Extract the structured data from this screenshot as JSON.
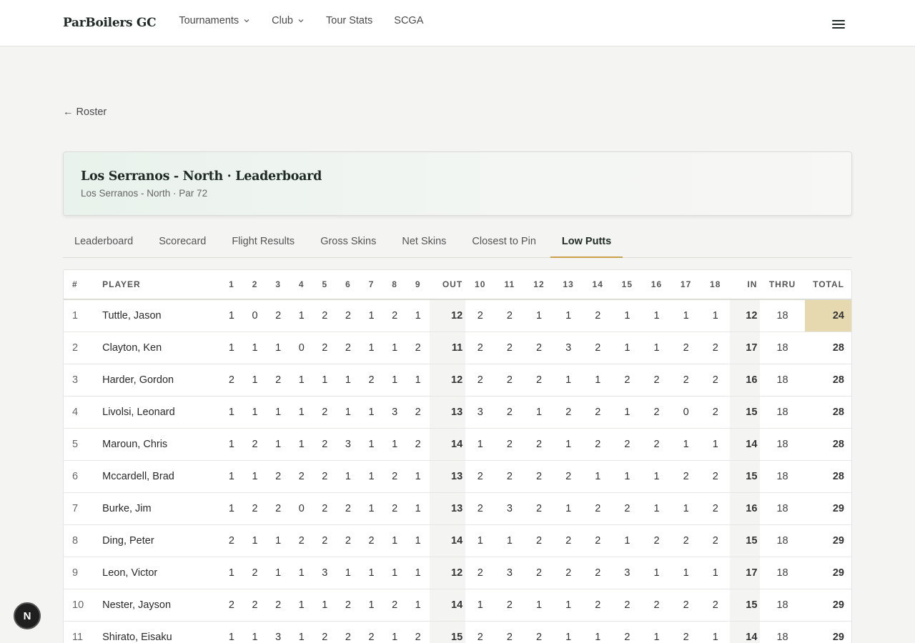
{
  "nav": {
    "brand": "ParBoilers GC",
    "links": [
      {
        "label": "Tournaments",
        "dropdown": true
      },
      {
        "label": "Club",
        "dropdown": true
      },
      {
        "label": "Tour Stats",
        "dropdown": false
      },
      {
        "label": "SCGA",
        "dropdown": false
      }
    ],
    "menu_icon": "hamburger-icon"
  },
  "back_link": "← Roster",
  "header": {
    "title": "Los Serranos - North · Leaderboard",
    "subtitle": "Los Serranos - North · Par 72"
  },
  "tabs": [
    "Leaderboard",
    "Scorecard",
    "Flight Results",
    "Gross Skins",
    "Net Skins",
    "Closest to Pin",
    "Low Putts"
  ],
  "active_tab": "Low Putts",
  "table": {
    "columns": [
      "#",
      "PLAYER",
      "1",
      "2",
      "3",
      "4",
      "5",
      "6",
      "7",
      "8",
      "9",
      "OUT",
      "10",
      "11",
      "12",
      "13",
      "14",
      "15",
      "16",
      "17",
      "18",
      "IN",
      "THRU",
      "TOTAL"
    ],
    "rows": [
      {
        "rank": "1",
        "player": "Tuttle, Jason",
        "front": [
          "1",
          "0",
          "2",
          "1",
          "2",
          "2",
          "1",
          "2",
          "1"
        ],
        "out": "12",
        "back": [
          "2",
          "2",
          "1",
          "1",
          "2",
          "1",
          "1",
          "1",
          "1"
        ],
        "in": "12",
        "thru": "18",
        "total": "24"
      },
      {
        "rank": "2",
        "player": "Clayton, Ken",
        "front": [
          "1",
          "1",
          "1",
          "0",
          "2",
          "2",
          "1",
          "1",
          "2"
        ],
        "out": "11",
        "back": [
          "2",
          "2",
          "2",
          "3",
          "2",
          "1",
          "1",
          "2",
          "2"
        ],
        "in": "17",
        "thru": "18",
        "total": "28"
      },
      {
        "rank": "3",
        "player": "Harder, Gordon",
        "front": [
          "2",
          "1",
          "2",
          "1",
          "1",
          "1",
          "2",
          "1",
          "1"
        ],
        "out": "12",
        "back": [
          "2",
          "2",
          "2",
          "1",
          "1",
          "2",
          "2",
          "2",
          "2"
        ],
        "in": "16",
        "thru": "18",
        "total": "28"
      },
      {
        "rank": "4",
        "player": "Livolsi, Leonard",
        "front": [
          "1",
          "1",
          "1",
          "1",
          "2",
          "1",
          "1",
          "3",
          "2"
        ],
        "out": "13",
        "back": [
          "3",
          "2",
          "1",
          "2",
          "2",
          "1",
          "2",
          "0",
          "2"
        ],
        "in": "15",
        "thru": "18",
        "total": "28"
      },
      {
        "rank": "5",
        "player": "Maroun, Chris",
        "front": [
          "1",
          "2",
          "1",
          "1",
          "2",
          "3",
          "1",
          "1",
          "2"
        ],
        "out": "14",
        "back": [
          "1",
          "2",
          "2",
          "1",
          "2",
          "2",
          "2",
          "1",
          "1"
        ],
        "in": "14",
        "thru": "18",
        "total": "28"
      },
      {
        "rank": "6",
        "player": "Mccardell, Brad",
        "front": [
          "1",
          "1",
          "2",
          "2",
          "2",
          "1",
          "1",
          "2",
          "1"
        ],
        "out": "13",
        "back": [
          "2",
          "2",
          "2",
          "2",
          "1",
          "1",
          "1",
          "2",
          "2"
        ],
        "in": "15",
        "thru": "18",
        "total": "28"
      },
      {
        "rank": "7",
        "player": "Burke, Jim",
        "front": [
          "1",
          "2",
          "2",
          "0",
          "2",
          "2",
          "1",
          "2",
          "1"
        ],
        "out": "13",
        "back": [
          "2",
          "3",
          "2",
          "1",
          "2",
          "2",
          "1",
          "1",
          "2"
        ],
        "in": "16",
        "thru": "18",
        "total": "29"
      },
      {
        "rank": "8",
        "player": "Ding, Peter",
        "front": [
          "2",
          "1",
          "1",
          "2",
          "2",
          "2",
          "2",
          "1",
          "1"
        ],
        "out": "14",
        "back": [
          "1",
          "1",
          "2",
          "2",
          "2",
          "1",
          "2",
          "2",
          "2"
        ],
        "in": "15",
        "thru": "18",
        "total": "29"
      },
      {
        "rank": "9",
        "player": "Leon, Victor",
        "front": [
          "1",
          "2",
          "1",
          "1",
          "3",
          "1",
          "1",
          "1",
          "1"
        ],
        "out": "12",
        "back": [
          "2",
          "3",
          "2",
          "2",
          "2",
          "3",
          "1",
          "1",
          "1"
        ],
        "in": "17",
        "thru": "18",
        "total": "29"
      },
      {
        "rank": "10",
        "player": "Nester, Jayson",
        "front": [
          "2",
          "2",
          "2",
          "1",
          "1",
          "2",
          "1",
          "2",
          "1"
        ],
        "out": "14",
        "back": [
          "1",
          "2",
          "1",
          "1",
          "2",
          "2",
          "2",
          "2",
          "2"
        ],
        "in": "15",
        "thru": "18",
        "total": "29"
      },
      {
        "rank": "11",
        "player": "Shirato, Eisaku",
        "front": [
          "1",
          "1",
          "3",
          "1",
          "2",
          "2",
          "2",
          "1",
          "2"
        ],
        "out": "15",
        "back": [
          "2",
          "2",
          "2",
          "1",
          "1",
          "2",
          "1",
          "2",
          "1"
        ],
        "in": "14",
        "thru": "18",
        "total": "29"
      }
    ]
  },
  "badge": "N",
  "colors": {
    "accent": "#c9a24a",
    "lead_total": "#e6d9b0",
    "brand": "#1f2a24"
  }
}
